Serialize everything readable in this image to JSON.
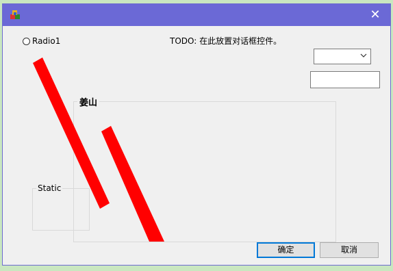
{
  "window": {
    "close_glyph": "✕"
  },
  "radio": {
    "label": "Radio1"
  },
  "todo_text": "TODO: 在此放置对话框控件。",
  "group": {
    "title": "姜山"
  },
  "static": {
    "label": "Static"
  },
  "buttons": {
    "ok": "确定",
    "cancel": "取消"
  },
  "colors": {
    "titlebar": "#6b69d6",
    "slash": "#ff0000",
    "default_button_border": "#0078d7"
  }
}
